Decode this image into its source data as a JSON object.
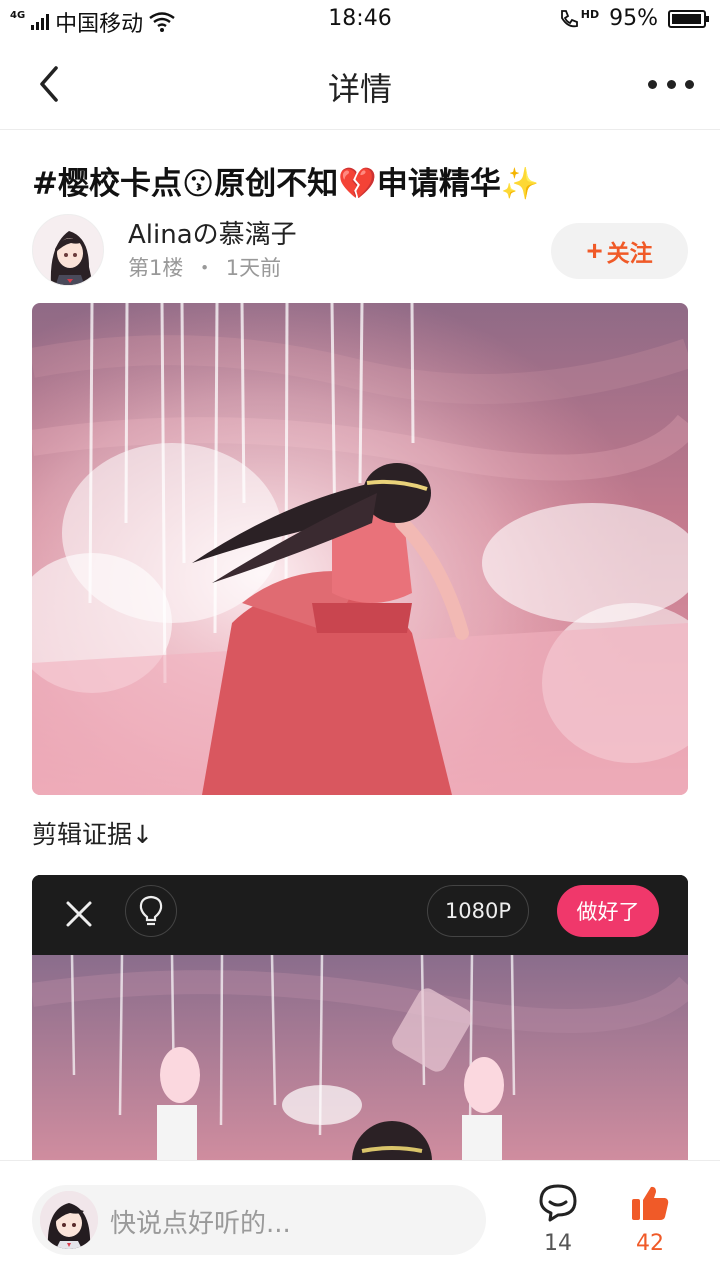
{
  "status_bar": {
    "network": "4G",
    "carrier": "中国移动",
    "time": "18:46",
    "hd": "HD",
    "battery": "95%",
    "battery_level": 0.95
  },
  "nav": {
    "title": "详情",
    "back_icon": "chevron-left-icon",
    "more_icon": "more-dots-icon"
  },
  "post": {
    "title": "#樱校卡点😗原创不知💔申请精华✨",
    "author": "Alinaの慕漓子",
    "floor": "第1楼",
    "separator": "・",
    "time_ago": "1天前",
    "follow_label": "关注",
    "caption": "剪辑证据↓"
  },
  "editor": {
    "resolution": "1080P",
    "done_label": "做好了",
    "close_icon": "close-icon",
    "bulb_icon": "lightbulb-icon"
  },
  "bottom": {
    "placeholder": "快说点好听的...",
    "comment_count": "14",
    "like_count": "42",
    "comment_icon": "comment-bubble-icon",
    "like_icon": "thumbs-up-icon"
  },
  "colors": {
    "accent": "#f05a28",
    "done_button": "#f0386b",
    "scene_pink": "#e8899a"
  }
}
